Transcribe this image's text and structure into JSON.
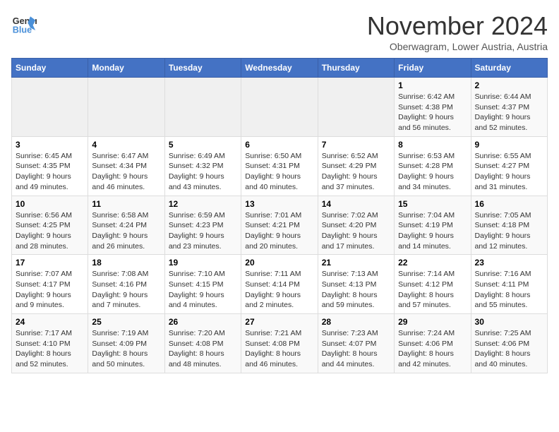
{
  "logo": {
    "line1": "General",
    "line2": "Blue"
  },
  "title": "November 2024",
  "subtitle": "Oberwagram, Lower Austria, Austria",
  "headers": [
    "Sunday",
    "Monday",
    "Tuesday",
    "Wednesday",
    "Thursday",
    "Friday",
    "Saturday"
  ],
  "weeks": [
    [
      {
        "day": "",
        "info": ""
      },
      {
        "day": "",
        "info": ""
      },
      {
        "day": "",
        "info": ""
      },
      {
        "day": "",
        "info": ""
      },
      {
        "day": "",
        "info": ""
      },
      {
        "day": "1",
        "info": "Sunrise: 6:42 AM\nSunset: 4:38 PM\nDaylight: 9 hours\nand 56 minutes."
      },
      {
        "day": "2",
        "info": "Sunrise: 6:44 AM\nSunset: 4:37 PM\nDaylight: 9 hours\nand 52 minutes."
      }
    ],
    [
      {
        "day": "3",
        "info": "Sunrise: 6:45 AM\nSunset: 4:35 PM\nDaylight: 9 hours\nand 49 minutes."
      },
      {
        "day": "4",
        "info": "Sunrise: 6:47 AM\nSunset: 4:34 PM\nDaylight: 9 hours\nand 46 minutes."
      },
      {
        "day": "5",
        "info": "Sunrise: 6:49 AM\nSunset: 4:32 PM\nDaylight: 9 hours\nand 43 minutes."
      },
      {
        "day": "6",
        "info": "Sunrise: 6:50 AM\nSunset: 4:31 PM\nDaylight: 9 hours\nand 40 minutes."
      },
      {
        "day": "7",
        "info": "Sunrise: 6:52 AM\nSunset: 4:29 PM\nDaylight: 9 hours\nand 37 minutes."
      },
      {
        "day": "8",
        "info": "Sunrise: 6:53 AM\nSunset: 4:28 PM\nDaylight: 9 hours\nand 34 minutes."
      },
      {
        "day": "9",
        "info": "Sunrise: 6:55 AM\nSunset: 4:27 PM\nDaylight: 9 hours\nand 31 minutes."
      }
    ],
    [
      {
        "day": "10",
        "info": "Sunrise: 6:56 AM\nSunset: 4:25 PM\nDaylight: 9 hours\nand 28 minutes."
      },
      {
        "day": "11",
        "info": "Sunrise: 6:58 AM\nSunset: 4:24 PM\nDaylight: 9 hours\nand 26 minutes."
      },
      {
        "day": "12",
        "info": "Sunrise: 6:59 AM\nSunset: 4:23 PM\nDaylight: 9 hours\nand 23 minutes."
      },
      {
        "day": "13",
        "info": "Sunrise: 7:01 AM\nSunset: 4:21 PM\nDaylight: 9 hours\nand 20 minutes."
      },
      {
        "day": "14",
        "info": "Sunrise: 7:02 AM\nSunset: 4:20 PM\nDaylight: 9 hours\nand 17 minutes."
      },
      {
        "day": "15",
        "info": "Sunrise: 7:04 AM\nSunset: 4:19 PM\nDaylight: 9 hours\nand 14 minutes."
      },
      {
        "day": "16",
        "info": "Sunrise: 7:05 AM\nSunset: 4:18 PM\nDaylight: 9 hours\nand 12 minutes."
      }
    ],
    [
      {
        "day": "17",
        "info": "Sunrise: 7:07 AM\nSunset: 4:17 PM\nDaylight: 9 hours\nand 9 minutes."
      },
      {
        "day": "18",
        "info": "Sunrise: 7:08 AM\nSunset: 4:16 PM\nDaylight: 9 hours\nand 7 minutes."
      },
      {
        "day": "19",
        "info": "Sunrise: 7:10 AM\nSunset: 4:15 PM\nDaylight: 9 hours\nand 4 minutes."
      },
      {
        "day": "20",
        "info": "Sunrise: 7:11 AM\nSunset: 4:14 PM\nDaylight: 9 hours\nand 2 minutes."
      },
      {
        "day": "21",
        "info": "Sunrise: 7:13 AM\nSunset: 4:13 PM\nDaylight: 8 hours\nand 59 minutes."
      },
      {
        "day": "22",
        "info": "Sunrise: 7:14 AM\nSunset: 4:12 PM\nDaylight: 8 hours\nand 57 minutes."
      },
      {
        "day": "23",
        "info": "Sunrise: 7:16 AM\nSunset: 4:11 PM\nDaylight: 8 hours\nand 55 minutes."
      }
    ],
    [
      {
        "day": "24",
        "info": "Sunrise: 7:17 AM\nSunset: 4:10 PM\nDaylight: 8 hours\nand 52 minutes."
      },
      {
        "day": "25",
        "info": "Sunrise: 7:19 AM\nSunset: 4:09 PM\nDaylight: 8 hours\nand 50 minutes."
      },
      {
        "day": "26",
        "info": "Sunrise: 7:20 AM\nSunset: 4:08 PM\nDaylight: 8 hours\nand 48 minutes."
      },
      {
        "day": "27",
        "info": "Sunrise: 7:21 AM\nSunset: 4:08 PM\nDaylight: 8 hours\nand 46 minutes."
      },
      {
        "day": "28",
        "info": "Sunrise: 7:23 AM\nSunset: 4:07 PM\nDaylight: 8 hours\nand 44 minutes."
      },
      {
        "day": "29",
        "info": "Sunrise: 7:24 AM\nSunset: 4:06 PM\nDaylight: 8 hours\nand 42 minutes."
      },
      {
        "day": "30",
        "info": "Sunrise: 7:25 AM\nSunset: 4:06 PM\nDaylight: 8 hours\nand 40 minutes."
      }
    ]
  ]
}
